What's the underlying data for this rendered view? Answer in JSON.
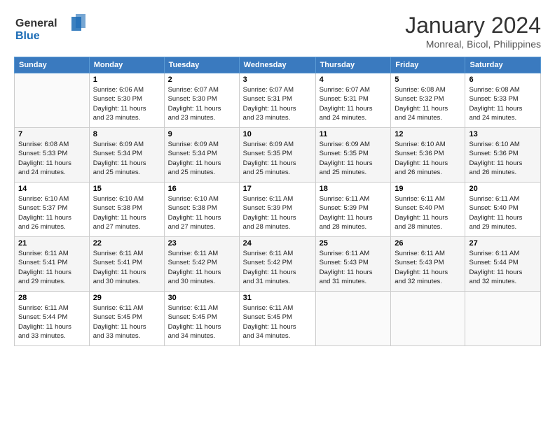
{
  "header": {
    "logo_general": "General",
    "logo_blue": "Blue",
    "month_title": "January 2024",
    "subtitle": "Monreal, Bicol, Philippines"
  },
  "columns": [
    "Sunday",
    "Monday",
    "Tuesday",
    "Wednesday",
    "Thursday",
    "Friday",
    "Saturday"
  ],
  "weeks": [
    [
      {
        "num": "",
        "info": ""
      },
      {
        "num": "1",
        "info": "Sunrise: 6:06 AM\nSunset: 5:30 PM\nDaylight: 11 hours\nand 23 minutes."
      },
      {
        "num": "2",
        "info": "Sunrise: 6:07 AM\nSunset: 5:30 PM\nDaylight: 11 hours\nand 23 minutes."
      },
      {
        "num": "3",
        "info": "Sunrise: 6:07 AM\nSunset: 5:31 PM\nDaylight: 11 hours\nand 23 minutes."
      },
      {
        "num": "4",
        "info": "Sunrise: 6:07 AM\nSunset: 5:31 PM\nDaylight: 11 hours\nand 24 minutes."
      },
      {
        "num": "5",
        "info": "Sunrise: 6:08 AM\nSunset: 5:32 PM\nDaylight: 11 hours\nand 24 minutes."
      },
      {
        "num": "6",
        "info": "Sunrise: 6:08 AM\nSunset: 5:33 PM\nDaylight: 11 hours\nand 24 minutes."
      }
    ],
    [
      {
        "num": "7",
        "info": "Sunrise: 6:08 AM\nSunset: 5:33 PM\nDaylight: 11 hours\nand 24 minutes."
      },
      {
        "num": "8",
        "info": "Sunrise: 6:09 AM\nSunset: 5:34 PM\nDaylight: 11 hours\nand 25 minutes."
      },
      {
        "num": "9",
        "info": "Sunrise: 6:09 AM\nSunset: 5:34 PM\nDaylight: 11 hours\nand 25 minutes."
      },
      {
        "num": "10",
        "info": "Sunrise: 6:09 AM\nSunset: 5:35 PM\nDaylight: 11 hours\nand 25 minutes."
      },
      {
        "num": "11",
        "info": "Sunrise: 6:09 AM\nSunset: 5:35 PM\nDaylight: 11 hours\nand 25 minutes."
      },
      {
        "num": "12",
        "info": "Sunrise: 6:10 AM\nSunset: 5:36 PM\nDaylight: 11 hours\nand 26 minutes."
      },
      {
        "num": "13",
        "info": "Sunrise: 6:10 AM\nSunset: 5:36 PM\nDaylight: 11 hours\nand 26 minutes."
      }
    ],
    [
      {
        "num": "14",
        "info": "Sunrise: 6:10 AM\nSunset: 5:37 PM\nDaylight: 11 hours\nand 26 minutes."
      },
      {
        "num": "15",
        "info": "Sunrise: 6:10 AM\nSunset: 5:38 PM\nDaylight: 11 hours\nand 27 minutes."
      },
      {
        "num": "16",
        "info": "Sunrise: 6:10 AM\nSunset: 5:38 PM\nDaylight: 11 hours\nand 27 minutes."
      },
      {
        "num": "17",
        "info": "Sunrise: 6:11 AM\nSunset: 5:39 PM\nDaylight: 11 hours\nand 28 minutes."
      },
      {
        "num": "18",
        "info": "Sunrise: 6:11 AM\nSunset: 5:39 PM\nDaylight: 11 hours\nand 28 minutes."
      },
      {
        "num": "19",
        "info": "Sunrise: 6:11 AM\nSunset: 5:40 PM\nDaylight: 11 hours\nand 28 minutes."
      },
      {
        "num": "20",
        "info": "Sunrise: 6:11 AM\nSunset: 5:40 PM\nDaylight: 11 hours\nand 29 minutes."
      }
    ],
    [
      {
        "num": "21",
        "info": "Sunrise: 6:11 AM\nSunset: 5:41 PM\nDaylight: 11 hours\nand 29 minutes."
      },
      {
        "num": "22",
        "info": "Sunrise: 6:11 AM\nSunset: 5:41 PM\nDaylight: 11 hours\nand 30 minutes."
      },
      {
        "num": "23",
        "info": "Sunrise: 6:11 AM\nSunset: 5:42 PM\nDaylight: 11 hours\nand 30 minutes."
      },
      {
        "num": "24",
        "info": "Sunrise: 6:11 AM\nSunset: 5:42 PM\nDaylight: 11 hours\nand 31 minutes."
      },
      {
        "num": "25",
        "info": "Sunrise: 6:11 AM\nSunset: 5:43 PM\nDaylight: 11 hours\nand 31 minutes."
      },
      {
        "num": "26",
        "info": "Sunrise: 6:11 AM\nSunset: 5:43 PM\nDaylight: 11 hours\nand 32 minutes."
      },
      {
        "num": "27",
        "info": "Sunrise: 6:11 AM\nSunset: 5:44 PM\nDaylight: 11 hours\nand 32 minutes."
      }
    ],
    [
      {
        "num": "28",
        "info": "Sunrise: 6:11 AM\nSunset: 5:44 PM\nDaylight: 11 hours\nand 33 minutes."
      },
      {
        "num": "29",
        "info": "Sunrise: 6:11 AM\nSunset: 5:45 PM\nDaylight: 11 hours\nand 33 minutes."
      },
      {
        "num": "30",
        "info": "Sunrise: 6:11 AM\nSunset: 5:45 PM\nDaylight: 11 hours\nand 34 minutes."
      },
      {
        "num": "31",
        "info": "Sunrise: 6:11 AM\nSunset: 5:45 PM\nDaylight: 11 hours\nand 34 minutes."
      },
      {
        "num": "",
        "info": ""
      },
      {
        "num": "",
        "info": ""
      },
      {
        "num": "",
        "info": ""
      }
    ]
  ]
}
